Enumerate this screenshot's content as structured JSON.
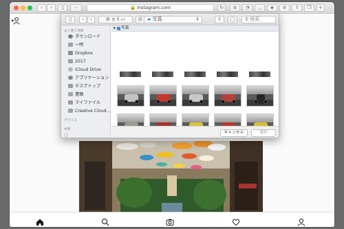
{
  "browser": {
    "url": "instagram.com",
    "colors": {
      "close": "#fd5f57",
      "minimize": "#febc2e",
      "zoom": "#28c840"
    }
  },
  "dialog": {
    "folder": "写真",
    "search_placeholder": "検索",
    "sidebar": {
      "favorites_header": "よく使う項目",
      "favorites": [
        {
          "label": "ダウンロード",
          "icon": "download-icon"
        },
        {
          "label": "一時",
          "icon": "folder-icon"
        },
        {
          "label": "Dropbox",
          "icon": "dropbox-icon"
        },
        {
          "label": "2017",
          "icon": "folder-icon"
        },
        {
          "label": "iCloud Drive",
          "icon": "cloud-icon"
        },
        {
          "label": "アプリケーション",
          "icon": "applications-icon"
        },
        {
          "label": "デスクトップ",
          "icon": "desktop-icon"
        },
        {
          "label": "書類",
          "icon": "document-icon"
        },
        {
          "label": "マイファイル",
          "icon": "myfiles-icon"
        },
        {
          "label": "Creative Cloud...",
          "icon": "creative-cloud-icon"
        }
      ],
      "devices_header": "デバイス",
      "shared_header": "共有"
    },
    "cancel_label": "キャンセル",
    "select_label": "選択"
  },
  "nav_icons": [
    "home-icon",
    "search-icon",
    "camera-icon",
    "heart-icon",
    "profile-icon"
  ]
}
